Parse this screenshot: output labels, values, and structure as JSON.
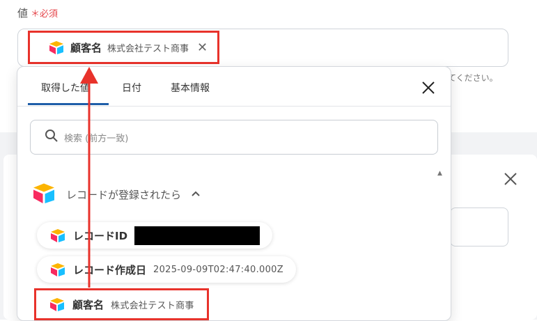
{
  "field": {
    "label": "値",
    "required_mark": "＊",
    "required_text": "必須",
    "helper_text": "てください。"
  },
  "chip": {
    "name": "顧客名",
    "value": "株式会社テスト商事",
    "icon": "airtable-logo-icon"
  },
  "popup": {
    "tabs": [
      {
        "label": "取得した値",
        "active": true
      },
      {
        "label": "日付",
        "active": false
      },
      {
        "label": "基本情報",
        "active": false
      }
    ],
    "search_placeholder": "検索 (前方一致)",
    "section_label": "レコードが登録されたら",
    "items": [
      {
        "name": "レコードID",
        "value": "",
        "redacted": true
      },
      {
        "name": "レコード作成日",
        "value": "2025-09-09T02:47:40.000Z"
      },
      {
        "name": "顧客名",
        "value": "株式会社テスト商事"
      }
    ]
  },
  "colors": {
    "accent": "#1f5ea8",
    "highlight": "#e8322b",
    "required": "#e5484d"
  }
}
